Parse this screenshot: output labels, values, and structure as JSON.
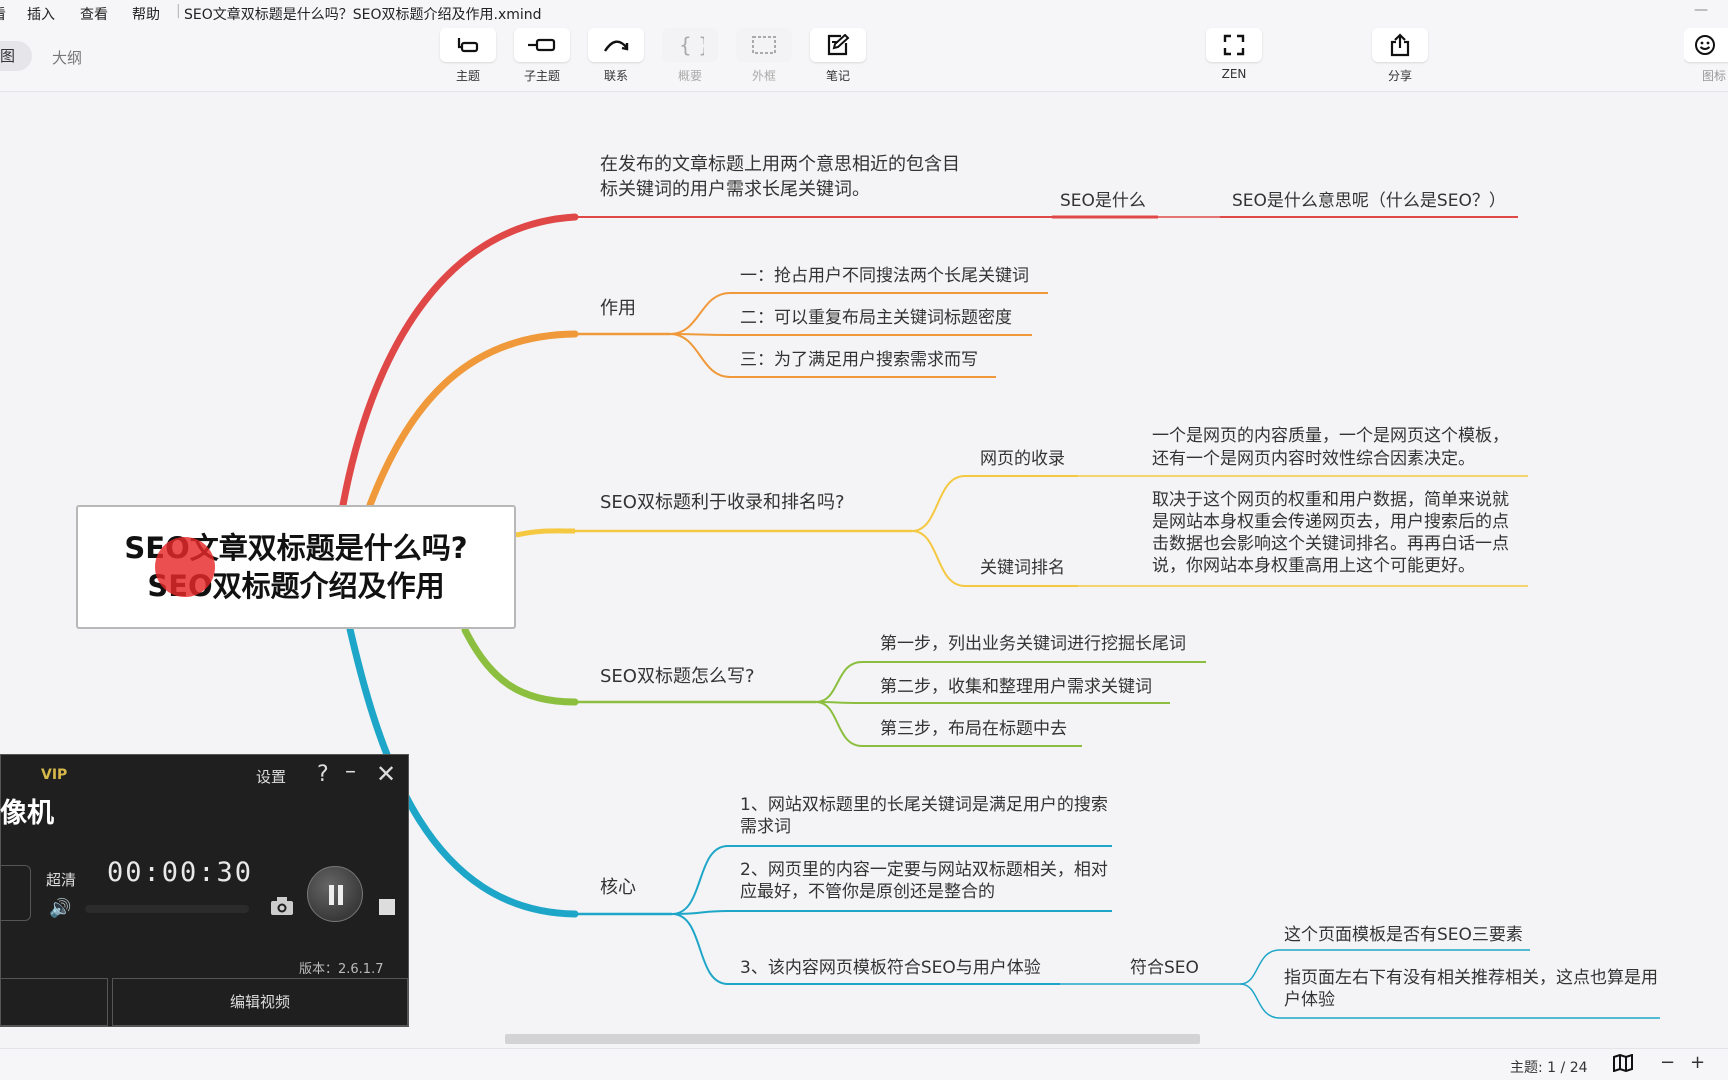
{
  "menubar": {
    "edge_item": "看",
    "insert": "插入",
    "view": "查看",
    "help": "帮助",
    "filename": "SEO文章双标题是什么吗？SEO双标题介绍及作用.xmind",
    "minimize": "—"
  },
  "view_tabs": {
    "map": "图",
    "outline": "大纲"
  },
  "toolbar": {
    "topic": "主题",
    "subtopic": "子主题",
    "relation": "联系",
    "summary": "概要",
    "boundary": "外框",
    "note": "笔记",
    "zen": "ZEN",
    "share": "分享",
    "icon": "图标"
  },
  "mindmap": {
    "root_line1": "SEO文章双标题是什么吗?",
    "root_line2": "SEO双标题介绍及作用",
    "b1": {
      "text": "在发布的文章标题上用两个意思相近的包含目标关键词的用户需求长尾关键词。",
      "child": "SEO是什么",
      "grandchild": "SEO是什么意思呢（什么是SEO？）",
      "color": "#e04848"
    },
    "b2": {
      "label": "作用",
      "items": [
        "一：抢占用户不同搜法两个长尾关键词",
        "二：可以重复布局主关键词标题密度",
        "三：为了满足用户搜索需求而写"
      ],
      "color": "#f0993a"
    },
    "b3": {
      "label": "SEO双标题利于收录和排名吗?",
      "c1": "网页的收录",
      "c1_text": "一个是网页的内容质量，一个是网页这个模板，还有一个是网页内容时效性综合因素决定。",
      "c2": "关键词排名",
      "c2_text": "取决于这个网页的权重和用户数据，简单来说就是网站本身权重会传递网页去，用户搜索后的点击数据也会影响这个关键词排名。再再白话一点说，你网站本身权重高用上这个可能更好。",
      "color": "#f5c842"
    },
    "b4": {
      "label": "SEO双标题怎么写?",
      "items": [
        "第一步，列出业务关键词进行挖掘长尾词",
        "第二步，收集和整理用户需求关键词",
        "第三步，布局在标题中去"
      ],
      "color": "#8cbf3f"
    },
    "b5": {
      "label": "核心",
      "item1": "1、网站双标题里的长尾关键词是满足用户的搜索需求词",
      "item2": "2、网页里的内容一定要与网站双标题相关，相对应最好，不管你是原创还是整合的",
      "item3": "3、该内容网页模板符合SEO与用户体验",
      "sub": "符合SEO",
      "sub1": "这个页面模板是否有SEO三要素",
      "sub2": "指页面左右下有没有相关推荐相关，这点也算是用户体验",
      "color": "#1ea6c8"
    }
  },
  "recorder": {
    "vip": "VIP",
    "settings": "设置",
    "help": "?",
    "title": "录像机",
    "quality": "超清",
    "time": "00:00:30",
    "version": "版本：2.6.1.7",
    "edit_video": "编辑视频"
  },
  "status": {
    "topic_count": "主题: 1 / 24",
    "zoom_out": "−",
    "zoom_in": "+"
  }
}
